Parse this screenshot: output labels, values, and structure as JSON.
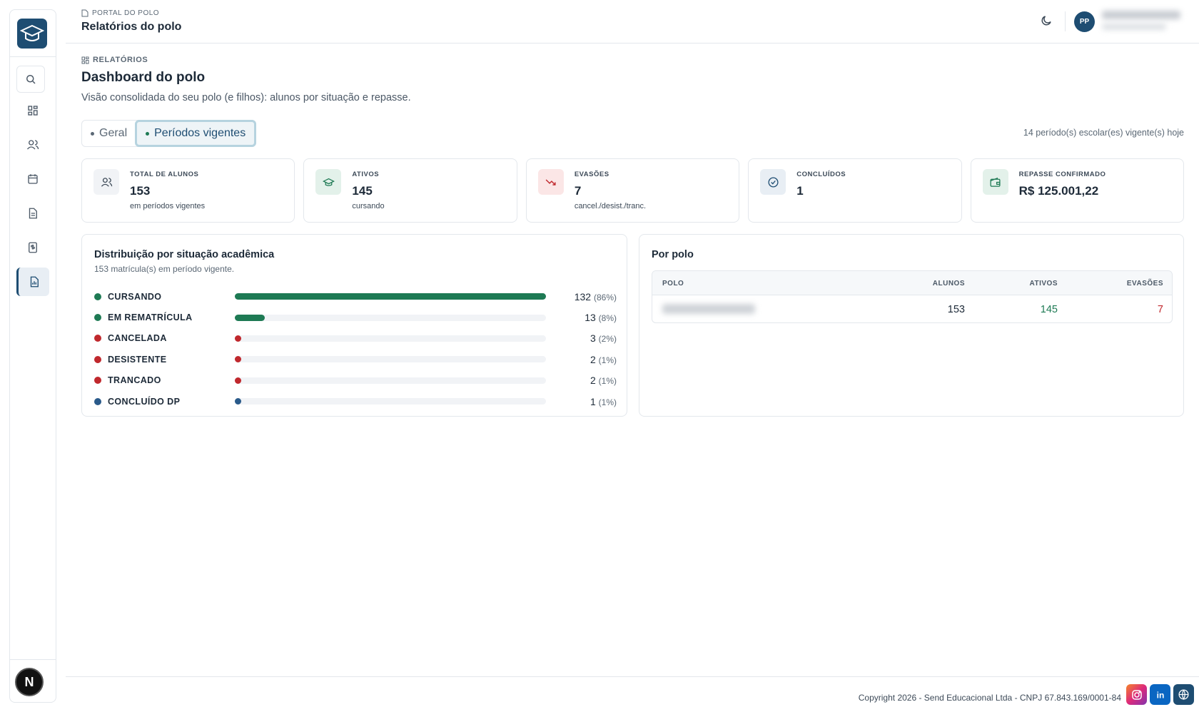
{
  "header": {
    "section": "PORTAL DO POLO",
    "title": "Relatórios do polo",
    "avatar_initials": "PP"
  },
  "sidebar": {
    "items": [
      {
        "icon": "search-icon"
      },
      {
        "icon": "dashboard-icon"
      },
      {
        "icon": "users-icon"
      },
      {
        "icon": "calendar-icon"
      },
      {
        "icon": "document-icon"
      },
      {
        "icon": "finance-icon"
      },
      {
        "icon": "report-icon",
        "active": true
      }
    ],
    "bottom_avatar": "N"
  },
  "page": {
    "section": "RELATÓRIOS",
    "title": "Dashboard do polo",
    "description": "Visão consolidada do seu polo (e filhos): alunos por situação e repasse.",
    "tabs": [
      {
        "label": "Geral",
        "active": false
      },
      {
        "label": "Períodos vigentes",
        "active": true
      }
    ],
    "periods_note": "14 período(s) escolar(es) vigente(s) hoje"
  },
  "kpis": [
    {
      "label": "TOTAL DE ALUNOS",
      "value": "153",
      "sub": "em períodos vigentes",
      "icon": "users-icon",
      "color": "#f1f3f6"
    },
    {
      "label": "ATIVOS",
      "value": "145",
      "sub": "cursando",
      "icon": "graduation-cap-icon",
      "color": "#e3f1ea"
    },
    {
      "label": "EVASÕES",
      "value": "7",
      "sub": "cancel./desist./tranc.",
      "icon": "trending-down-icon",
      "color": "#fbe6e6"
    },
    {
      "label": "CONCLUÍDOS",
      "value": "1",
      "sub": "",
      "icon": "check-circle-icon",
      "color": "#e8eef4"
    },
    {
      "label": "REPASSE CONFIRMADO",
      "value": "R$ 125.001,22",
      "sub": "",
      "icon": "wallet-icon",
      "color": "#e3f1ea"
    }
  ],
  "distribution": {
    "title": "Distribuição por situação acadêmica",
    "subtitle": "153 matrícula(s) em período vigente.",
    "rows": [
      {
        "label": "CURSANDO",
        "count": "132",
        "pct": "(86%)",
        "fraction": 0.86,
        "color": "#1e7a54"
      },
      {
        "label": "EM REMATRÍCULA",
        "count": "13",
        "pct": "(8%)",
        "fraction": 0.08,
        "color": "#1e7a54"
      },
      {
        "label": "CANCELADA",
        "count": "3",
        "pct": "(2%)",
        "fraction": 0.02,
        "color": "#c0282d"
      },
      {
        "label": "DESISTENTE",
        "count": "2",
        "pct": "(1%)",
        "fraction": 0.01,
        "color": "#c0282d"
      },
      {
        "label": "TRANCADO",
        "count": "2",
        "pct": "(1%)",
        "fraction": 0.01,
        "color": "#c0282d"
      },
      {
        "label": "CONCLUÍDO DP",
        "count": "1",
        "pct": "(1%)",
        "fraction": 0.01,
        "color": "#2a5a8a"
      }
    ]
  },
  "por_polo": {
    "title": "Por polo",
    "columns": [
      "POLO",
      "ALUNOS",
      "ATIVOS",
      "EVASÕES"
    ],
    "rows": [
      {
        "alunos": "153",
        "ativos": "145",
        "evasoes": "7"
      }
    ]
  },
  "footer": {
    "copyright": "Copyright 2026 - Send Educacional Ltda - CNPJ 67.843.169/0001-84",
    "social": [
      "instagram-icon",
      "linkedin-icon",
      "globe-icon"
    ]
  },
  "colors": {
    "brand": "#1e4d72",
    "success": "#1e7a54",
    "danger": "#c0282d"
  }
}
